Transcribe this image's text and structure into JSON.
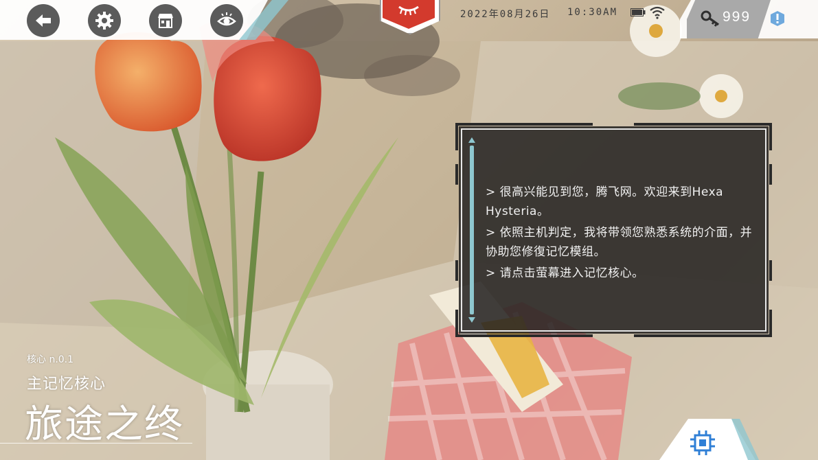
{
  "topbar": {
    "icons": [
      "back-arrow-icon",
      "gear-icon",
      "shop-icon",
      "eye-icon"
    ]
  },
  "status": {
    "date": "2022年08月26日",
    "time": "10:30AM"
  },
  "currency": {
    "key_count": "999"
  },
  "dialog": {
    "lines": [
      "> 很高兴能见到您，腾飞网。欢迎来到Hexa Hysteria。",
      "> 依照主机判定，我将带领您熟悉系统的介面，并协助您修復记忆模组。",
      "> 请点击萤幕进入记忆核心。"
    ]
  },
  "core": {
    "id": "核心 n.0.1",
    "subtitle": "主记忆核心",
    "title": "旅途之终"
  },
  "colors": {
    "accent_teal": "#8ec7cf",
    "alert_red": "#d33a2d",
    "chip_blue": "#2f7fd6"
  }
}
